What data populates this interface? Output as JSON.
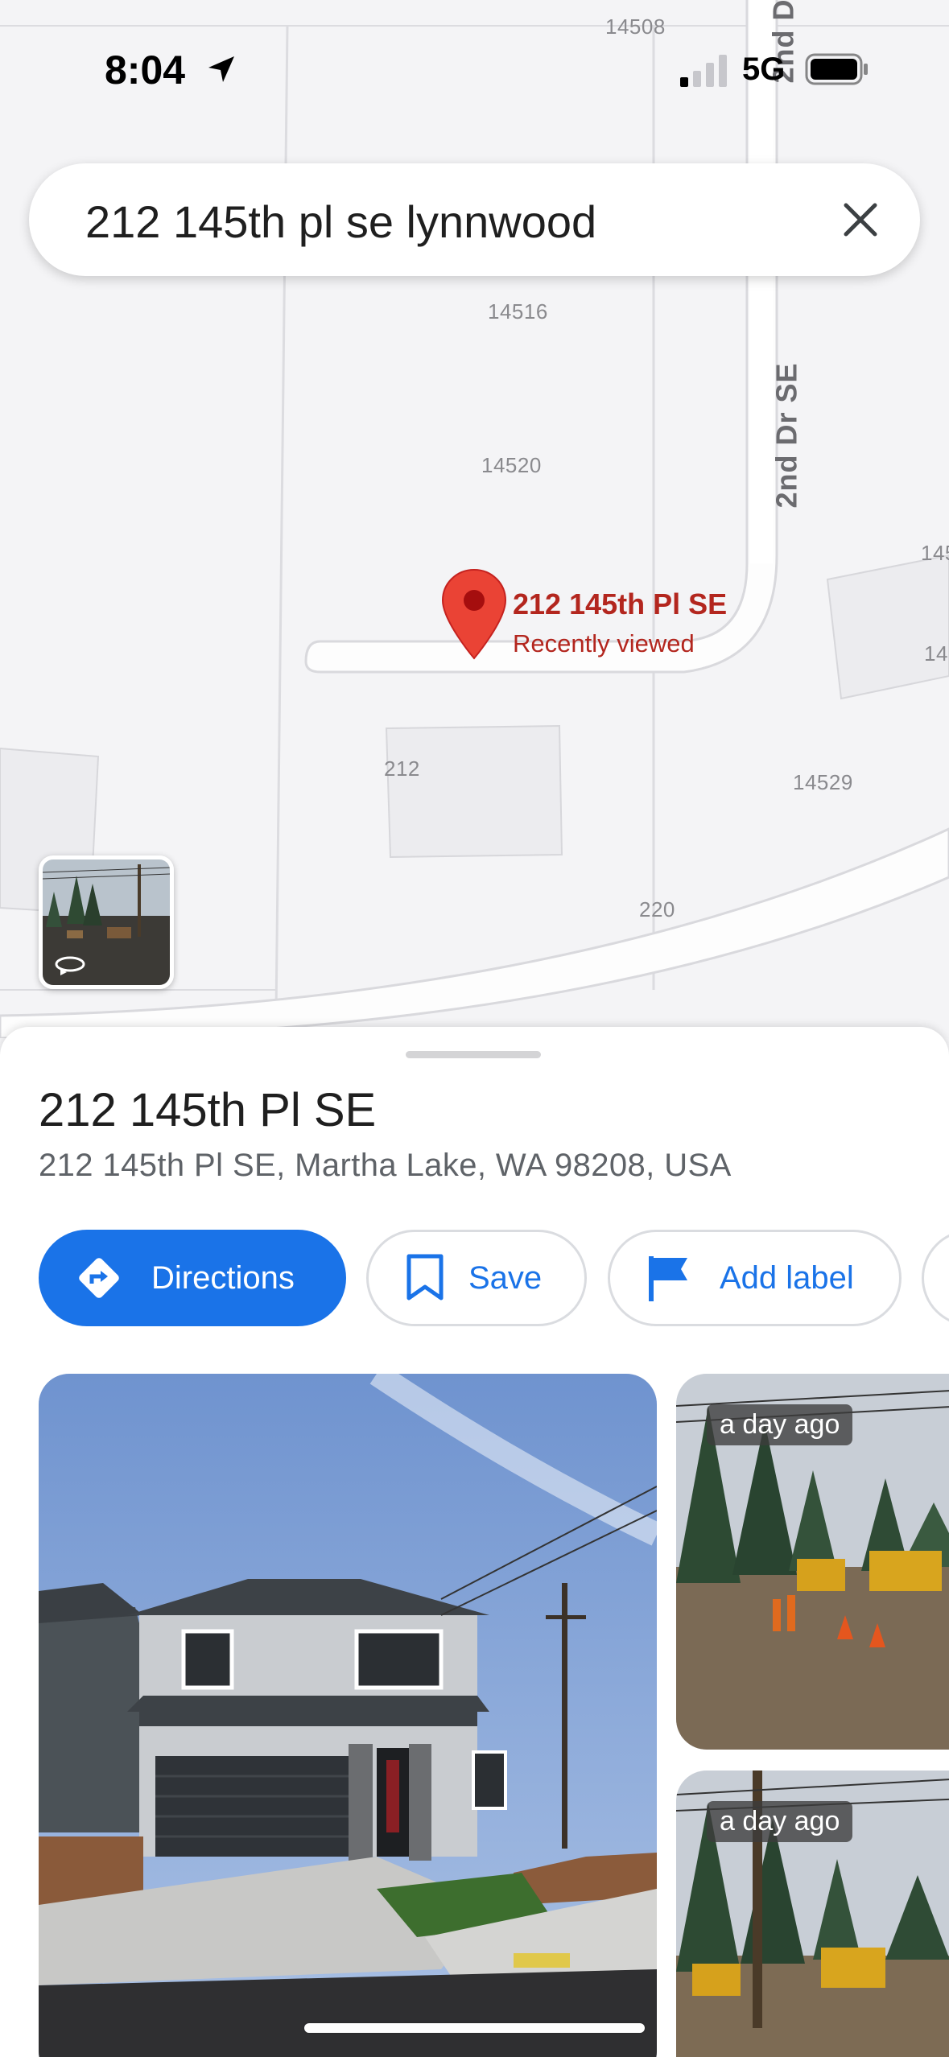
{
  "status_bar": {
    "time": "8:04",
    "network": "5G"
  },
  "search": {
    "query": "212 145th pl se lynnwood"
  },
  "map": {
    "parcel_labels": [
      "14508",
      "14516",
      "14520",
      "212",
      "14529",
      "220",
      "145",
      "14"
    ],
    "street_label": "2nd Dr SE",
    "street_label_top": "2nd D",
    "pin": {
      "title": "212 145th Pl SE",
      "subtitle": "Recently viewed"
    }
  },
  "place": {
    "title": "212 145th Pl SE",
    "address": "212 145th Pl SE, Martha Lake, WA 98208, USA"
  },
  "actions": {
    "directions": "Directions",
    "save": "Save",
    "add_label": "Add label"
  },
  "photos": {
    "side_1_badge": "a day ago",
    "side_2_badge": "a day ago"
  },
  "colors": {
    "accent": "#1a73e8",
    "pin": "#ea4335",
    "pin_text": "#b3261e"
  }
}
